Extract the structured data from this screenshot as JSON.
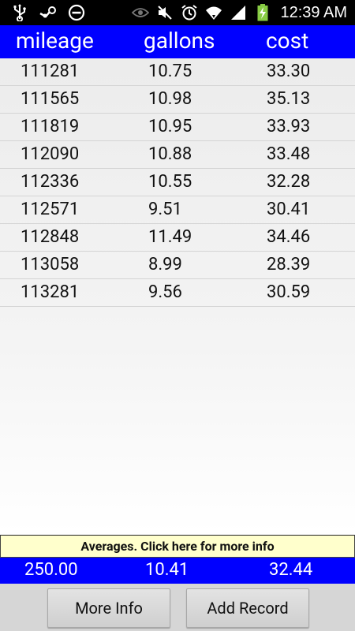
{
  "status_bar": {
    "time": "12:39 AM",
    "left_icons": [
      "usb-icon",
      "steam-icon",
      "do-not-disturb-icon"
    ],
    "right_icons": [
      "eye-icon",
      "mute-icon",
      "alarm-icon",
      "wifi-icon",
      "signal-icon",
      "battery-charging-icon"
    ]
  },
  "table": {
    "headers": [
      "mileage",
      "gallons",
      "cost"
    ],
    "rows": [
      [
        "111281",
        "10.75",
        "33.30"
      ],
      [
        "111565",
        "10.98",
        "35.13"
      ],
      [
        "111819",
        "10.95",
        "33.93"
      ],
      [
        "112090",
        "10.88",
        "33.48"
      ],
      [
        "112336",
        "10.55",
        "32.28"
      ],
      [
        "112571",
        "9.51",
        "30.41"
      ],
      [
        "112848",
        "11.49",
        "34.46"
      ],
      [
        "113058",
        "8.99",
        "28.39"
      ],
      [
        "113281",
        "9.56",
        "30.59"
      ]
    ]
  },
  "averages": {
    "label": "Averages. Click here for more info",
    "mileage": "250.00",
    "gallons": "10.41",
    "cost": "32.44"
  },
  "buttons": {
    "more_info": "More Info",
    "add_record": "Add Record"
  },
  "colors": {
    "header_bg": "#0000ff",
    "averages_label_bg": "#ffffcc",
    "status_bar_bg": "#000000"
  }
}
